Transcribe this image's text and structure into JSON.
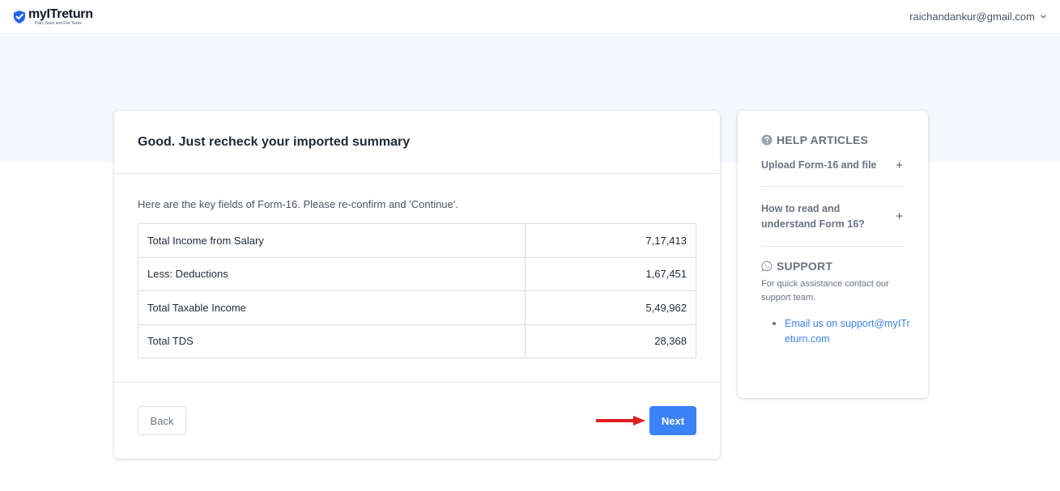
{
  "header": {
    "logo_name": "myITreturn",
    "logo_tagline": "Plan, Save and File Taxes",
    "user_email": "raichandankur@gmail.com"
  },
  "card": {
    "title": "Good. Just recheck your imported summary",
    "intro": "Here are the key fields of Form-16. Please re-confirm and 'Continue'.",
    "rows": [
      {
        "label": "Total Income from Salary",
        "value": "7,17,413"
      },
      {
        "label": "Less: Deductions",
        "value": "1,67,451"
      },
      {
        "label": "Total Taxable Income",
        "value": "5,49,962"
      },
      {
        "label": "Total TDS",
        "value": "28,368"
      }
    ],
    "back_label": "Back",
    "next_label": "Next"
  },
  "sidebar": {
    "help_heading": "HELP ARTICLES",
    "articles": [
      {
        "title": "Upload Form-16 and file"
      },
      {
        "title": "How to read and understand Form 16?"
      }
    ],
    "support_heading": "SUPPORT",
    "support_text": "For quick assistance contact our support team.",
    "support_link": "Email us on support@myITreturn.com"
  },
  "colors": {
    "accent": "#3b82f6",
    "arrow": "#e11d1d",
    "band": "#f5f7fc"
  }
}
